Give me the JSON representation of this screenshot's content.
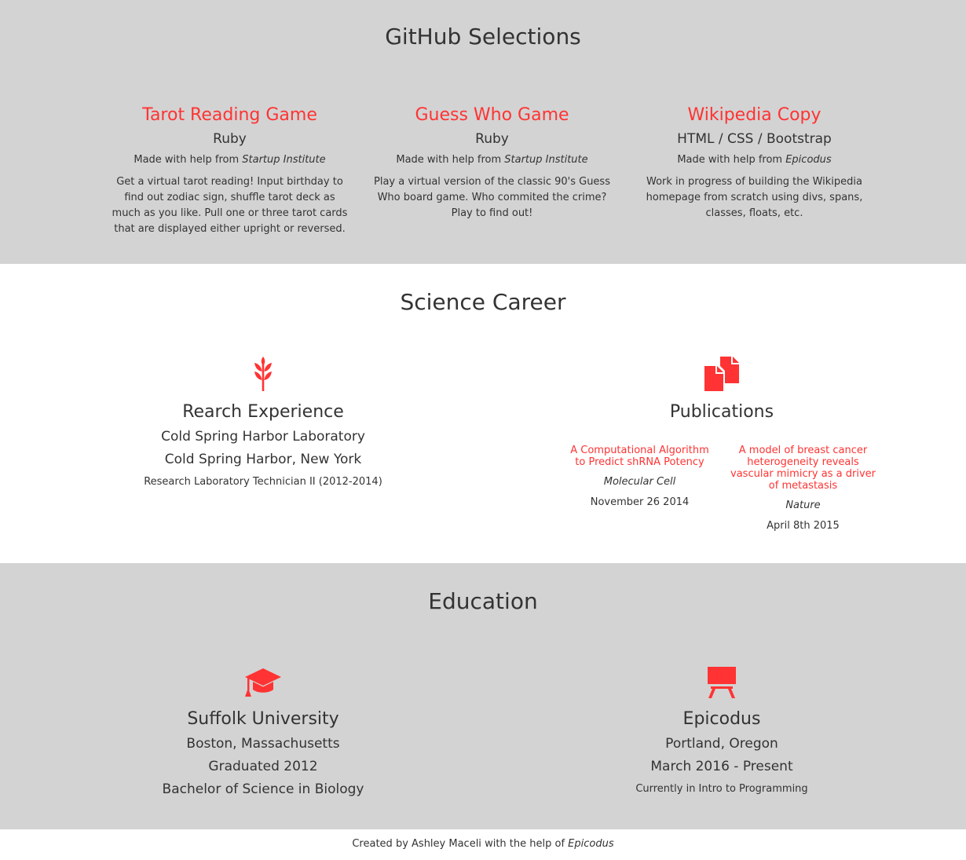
{
  "github": {
    "title": "GitHub Selections",
    "projects": [
      {
        "title": "Tarot Reading Game",
        "lang": "Ruby",
        "help_prefix": "Made with help from",
        "help_org": "Startup Institute",
        "desc": "Get a virtual tarot reading! Input birthday to find out zodiac sign, shuffle tarot deck as much as you like. Pull one or three tarot cards that are displayed either upright or reversed."
      },
      {
        "title": "Guess Who Game",
        "lang": "Ruby",
        "help_prefix": "Made with help from",
        "help_org": "Startup Institute",
        "desc": "Play a virtual version of the classic 90's Guess Who board game. Who commited the crime? Play to find out!"
      },
      {
        "title": "Wikipedia Copy",
        "lang": "HTML / CSS / Bootstrap",
        "help_prefix": "Made with help from",
        "help_org": "Epicodus",
        "desc": "Work in progress of building the Wikipedia homepage from scratch using divs, spans, classes, floats, etc."
      }
    ]
  },
  "science": {
    "title": "Science Career",
    "research": {
      "icon": "wheat-icon",
      "title": "Rearch Experience",
      "org": "Cold Spring Harbor Laboratory",
      "location": "Cold Spring Harbor, New York",
      "role": "Research Laboratory Technician II (2012-2014)"
    },
    "publications": {
      "icon": "documents-icon",
      "title": "Publications",
      "items": [
        {
          "title": "A Computational Algorithm to Predict shRNA Potency",
          "journal": "Molecular Cell",
          "date": "November 26 2014"
        },
        {
          "title": "A model of breast cancer heterogeneity reveals vascular mimicry as a driver of metastasis",
          "journal": "Nature",
          "date": "April 8th 2015"
        }
      ]
    }
  },
  "education": {
    "title": "Education",
    "schools": [
      {
        "icon": "graduation-cap-icon",
        "name": "Suffolk University",
        "location": "Boston, Massachusetts",
        "detail": "Graduated 2012",
        "degree": "Bachelor of Science in Biology"
      },
      {
        "icon": "easel-icon",
        "name": "Epicodus",
        "location": "Portland, Oregon",
        "detail": "March 2016 - Present",
        "degree": "Currently in Intro to Programming"
      }
    ]
  },
  "footer": {
    "prefix": "Created by",
    "author": "Ashley Maceli",
    "middle": "with the help of",
    "org": "Epicodus"
  },
  "colors": {
    "accent": "#ff3333",
    "grey_bg": "#d3d3d3",
    "text": "#333333"
  }
}
